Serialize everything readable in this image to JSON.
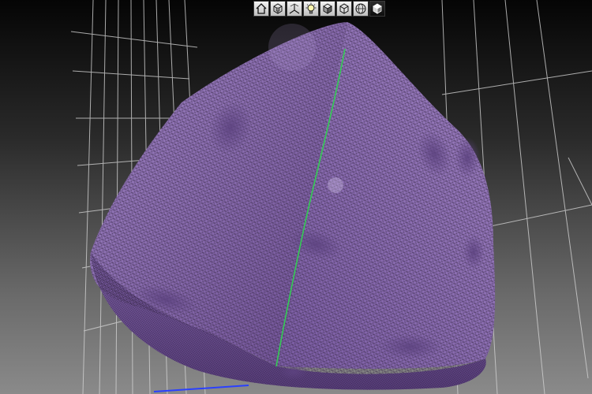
{
  "viewer": {
    "toolbar": {
      "buttons": [
        {
          "id": "home",
          "icon": "home-icon",
          "active": false
        },
        {
          "id": "view-front",
          "icon": "cube-front-icon",
          "active": false
        },
        {
          "id": "view-axes",
          "icon": "axes-view-icon",
          "active": false
        },
        {
          "id": "lighting",
          "icon": "lightbulb-icon",
          "active": false
        },
        {
          "id": "shaded",
          "icon": "cube-shaded-icon",
          "active": false
        },
        {
          "id": "wireframe",
          "icon": "cube-wireframe-icon",
          "active": false
        },
        {
          "id": "sphere",
          "icon": "sphere-grid-icon",
          "active": false
        },
        {
          "id": "solid",
          "icon": "cube-solid-icon",
          "active": true
        }
      ]
    },
    "scene": {
      "object": "rounded-die-mesh",
      "mesh_color": "#8a6ab0",
      "wire_color": "#3a2a4a",
      "edge_highlight_color": "#33cc55",
      "grid_color": "#cfcfcf",
      "axis_color": "#2a40ff",
      "background_top": "#050505",
      "background_bottom": "#8a8a8a"
    }
  }
}
